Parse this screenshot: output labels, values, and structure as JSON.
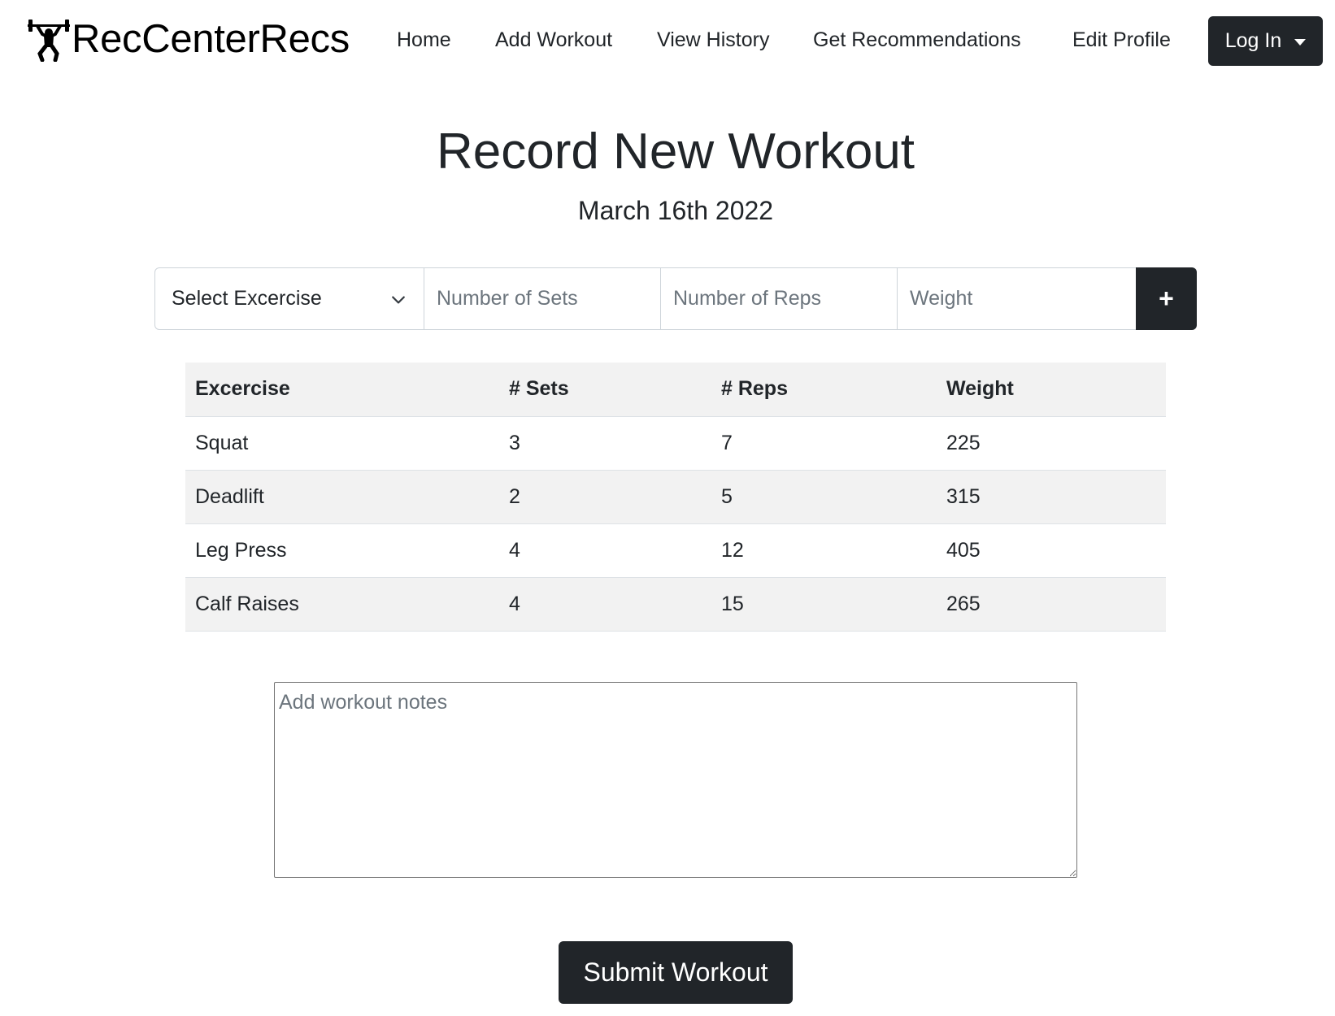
{
  "nav": {
    "brand": "RecCenterRecs",
    "brand_icon": "weightlifter-icon",
    "links": [
      "Home",
      "Add Workout",
      "View History",
      "Get Recommendations",
      "Edit Profile"
    ],
    "login_label": "Log In",
    "login_icon": "caret-down-icon"
  },
  "page": {
    "title": "Record New Workout",
    "date": "March 16th 2022"
  },
  "entry": {
    "exercise_select": "Select Excercise",
    "sets_placeholder": "Number of Sets",
    "reps_placeholder": "Number of Reps",
    "weight_placeholder": "Weight",
    "add_label": "+"
  },
  "table": {
    "headers": [
      "Excercise",
      "# Sets",
      "# Reps",
      "Weight"
    ],
    "rows": [
      [
        "Squat",
        "3",
        "7",
        "225"
      ],
      [
        "Deadlift",
        "2",
        "5",
        "315"
      ],
      [
        "Leg Press",
        "4",
        "12",
        "405"
      ],
      [
        "Calf Raises",
        "4",
        "15",
        "265"
      ]
    ]
  },
  "notes": {
    "placeholder": "Add workout notes",
    "value": ""
  },
  "submit_label": "Submit Workout",
  "colors": {
    "primary_dark": "#212529",
    "stripe": "#f2f2f2",
    "border": "#ced4da",
    "placeholder": "#6c757d"
  }
}
